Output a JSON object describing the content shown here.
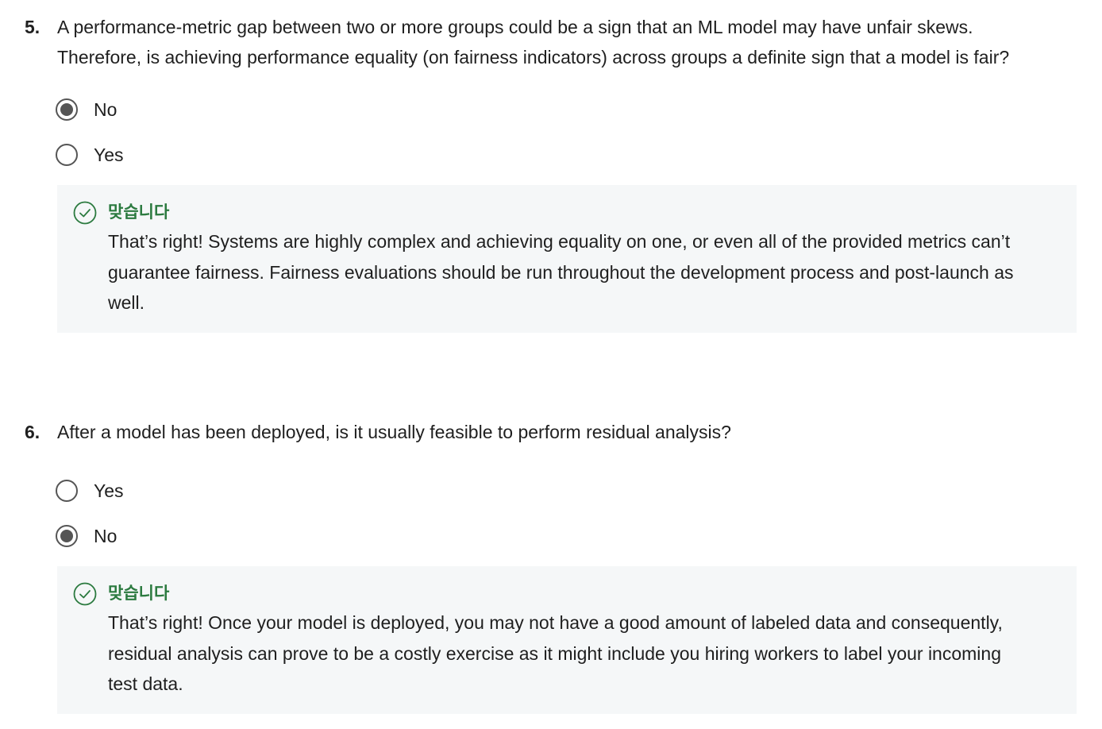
{
  "questions": [
    {
      "number": "5.",
      "text_line1": "A performance-metric gap between two or more groups could be a sign that an ML model may have unfair skews.",
      "text_line2": "Therefore, is achieving performance equality (on fairness indicators) across groups a definite sign that a model is fair?",
      "options": [
        {
          "label": "No",
          "selected": true
        },
        {
          "label": "Yes",
          "selected": false
        }
      ],
      "feedback": {
        "status": "맞습니다",
        "line1": "That’s right! Systems are highly complex and achieving equality on one, or even all of the provided metrics can’t",
        "line2": "guarantee fairness. Fairness evaluations should be run throughout the development process and post-launch as",
        "line3": "well."
      }
    },
    {
      "number": "6.",
      "text_line1": "After a model has been deployed, is it usually feasible to perform residual analysis?",
      "options": [
        {
          "label": "Yes",
          "selected": false
        },
        {
          "label": "No",
          "selected": true
        }
      ],
      "feedback": {
        "status": "맞습니다",
        "line1": "That’s right! Once your model is deployed, you may not have a good amount of labeled data and consequently,",
        "line2": "residual analysis can prove to be a costly exercise as it might include you hiring workers to label your incoming",
        "line3": "test data."
      }
    }
  ],
  "colors": {
    "correct": "#2b7a3f",
    "radio": "#555555",
    "feedback_bg": "#f5f7f8"
  }
}
